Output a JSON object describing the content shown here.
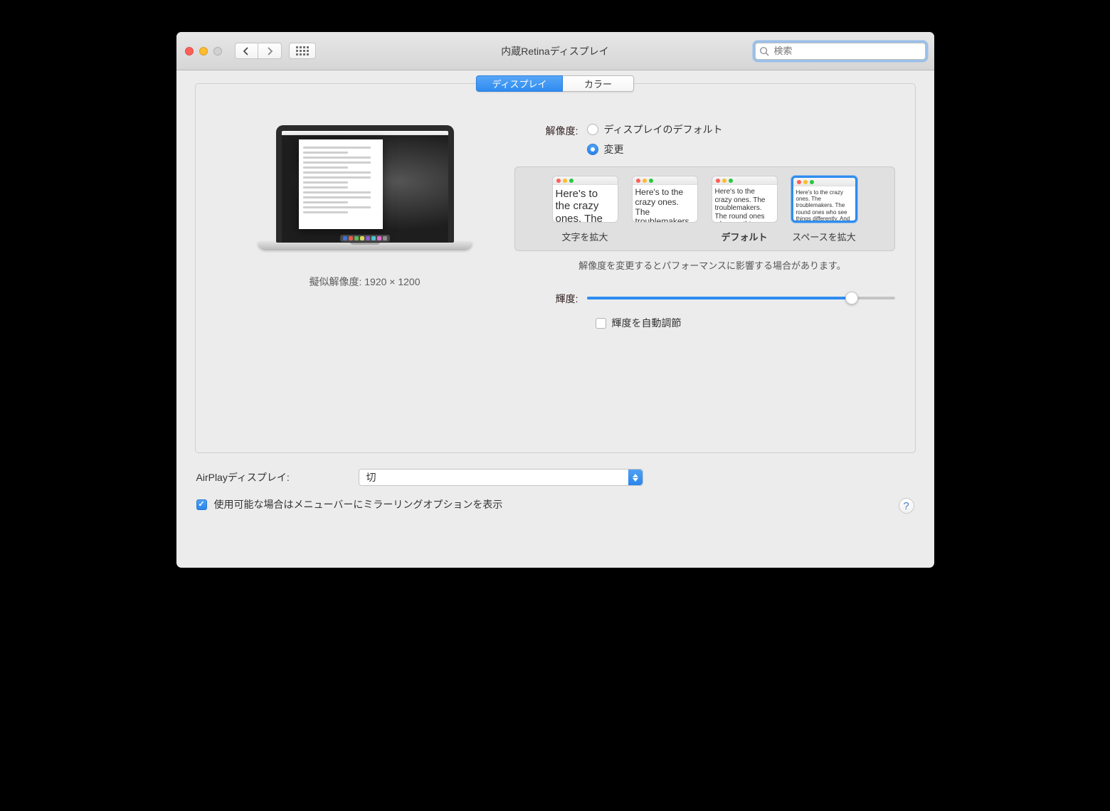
{
  "titlebar": {
    "title": "内蔵Retinaディスプレイ",
    "search_placeholder": "検索"
  },
  "tabs": {
    "display": "ディスプレイ",
    "color": "カラー"
  },
  "left": {
    "resolution_caption": "擬似解像度: 1920 × 1200"
  },
  "resolution": {
    "label": "解像度:",
    "option_default": "ディスプレイのデフォルト",
    "option_scaled": "変更",
    "selected": "scaled"
  },
  "scaling": {
    "items": [
      {
        "label": "文字を拡大",
        "selected": false
      },
      {
        "label": "",
        "selected": false
      },
      {
        "label": "デフォルト",
        "selected": false
      },
      {
        "label": "スペースを拡大",
        "selected": true
      }
    ],
    "sample_text": "Here's to the crazy ones. The troublemakers. The round ones who see things differently. And they have no rules. And they can quote them, disagree. About the only thing. Because they change it.",
    "performance_warning": "解像度を変更するとパフォーマンスに影響する場合があります。"
  },
  "brightness": {
    "label": "輝度:",
    "value_fraction": 0.86,
    "auto_label": "輝度を自動調節",
    "auto_checked": false
  },
  "airplay": {
    "label": "AirPlayディスプレイ:",
    "value": "切"
  },
  "footer": {
    "mirror_label": "使用可能な場合はメニューバーにミラーリングオプションを表示",
    "mirror_checked": true,
    "help": "?"
  }
}
